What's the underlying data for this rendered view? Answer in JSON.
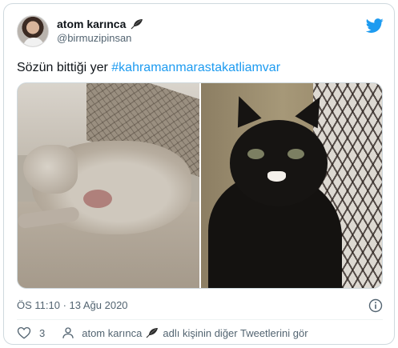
{
  "author": {
    "display_name": "atom karınca",
    "handle": "@birmuzipinsan"
  },
  "tweet": {
    "text": "Sözün bittiği yer ",
    "hashtag": "#kahramanmarastakatliamvar"
  },
  "meta": {
    "timestamp": "ÖS 11:10 · 13 Ağu 2020"
  },
  "actions": {
    "like_count": "3",
    "more_from_name": "atom karınca",
    "more_from_suffix": "adlı kişinin diğer Tweetlerini gör"
  },
  "colors": {
    "accent": "#1d9bf0",
    "secondary_text": "#536471",
    "border": "#cfd9de"
  },
  "icons": {
    "brand": "twitter-bird-icon",
    "name_emoji": "feather-icon",
    "info": "info-icon",
    "like": "heart-icon",
    "profile": "person-icon"
  }
}
